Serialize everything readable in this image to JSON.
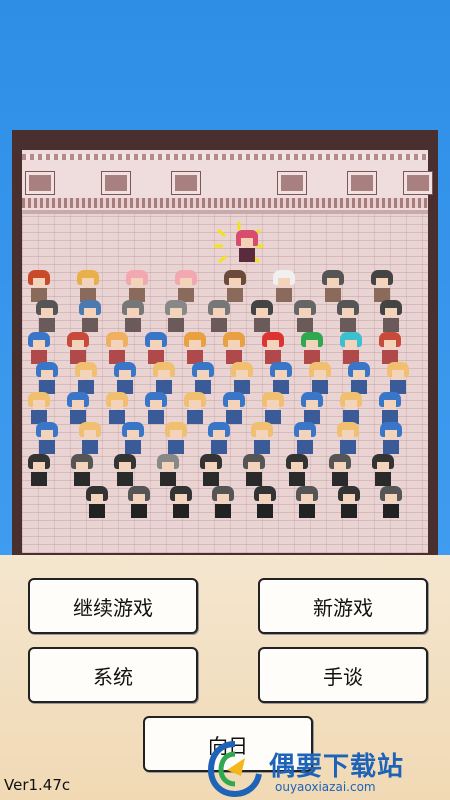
{
  "menu": {
    "continue_label": "继续游戏",
    "new_game_label": "新游戏",
    "system_label": "系统",
    "manual_label": "手谈",
    "back_label": "向日"
  },
  "version": "Ver1.47c",
  "watermark": {
    "title": "偶要下载站",
    "url": "ouyaoxiazai.com"
  },
  "colors": {
    "sky": "#3f9cf0",
    "hall_wall": "#e9d3d3",
    "frame": "#4a2f2f",
    "button_bg": "#fffdfa",
    "button_border": "#222222",
    "watermark": "#1d63b8"
  },
  "icons": {
    "spotlight": "yellow-spark-icon",
    "watermark_logo": "ouyao-logo-icon"
  }
}
